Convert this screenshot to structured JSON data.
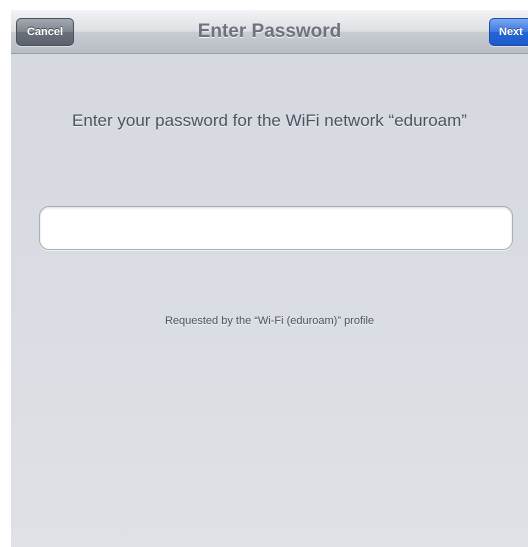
{
  "navbar": {
    "title": "Enter Password",
    "cancel_label": "Cancel",
    "next_label": "Next"
  },
  "prompt": {
    "text": "Enter your password for the WiFi network “eduroam”"
  },
  "password_field": {
    "value": "",
    "placeholder": ""
  },
  "footer": {
    "requested_text": "Requested by the “Wi-Fi (eduroam)” profile"
  },
  "colors": {
    "next_button": "#2565d6",
    "cancel_button": "#6a7079",
    "background": "#d8dbe2"
  }
}
